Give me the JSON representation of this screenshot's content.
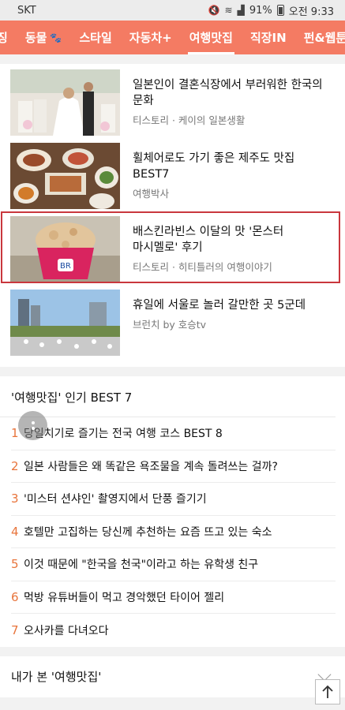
{
  "status": {
    "carrier": "SKT",
    "battery": "91%",
    "time": "오전 9:33"
  },
  "tabs": [
    {
      "label": "징"
    },
    {
      "label": "동물"
    },
    {
      "label": "스타일"
    },
    {
      "label": "자동차+"
    },
    {
      "label": "여행맛집"
    },
    {
      "label": "직장IN"
    },
    {
      "label": "펀&웹툰"
    }
  ],
  "articles": [
    {
      "title": "일본인이 결혼식장에서 부러워한 한국의 문화",
      "source": "티스토리 · 케이의 일본생활"
    },
    {
      "title": "휠체어로도 가기 좋은 제주도 맛집 BEST7",
      "source": "여행박사"
    },
    {
      "title": "배스킨라빈스 이달의 맛 '몬스터 마시멜로' 후기",
      "source": "티스토리 · 히티틀러의 여행이야기"
    },
    {
      "title": "휴일에 서울로 놀러 갈만한 곳 5군데",
      "source": "브런치 by 호승tv"
    }
  ],
  "best": {
    "title": "'여행맛집' 인기 BEST 7",
    "items": [
      {
        "rank": "1",
        "text": "당일치기로 즐기는 전국 여행 코스 BEST 8"
      },
      {
        "rank": "2",
        "text": "일본 사람들은 왜 똑같은 욕조물을 계속 돌려쓰는 걸까?"
      },
      {
        "rank": "3",
        "text": "'미스터 션샤인' 촬영지에서 단풍 즐기기"
      },
      {
        "rank": "4",
        "text": "호텔만 고집하는 당신께 추천하는 요즘 뜨고 있는 숙소"
      },
      {
        "rank": "5",
        "text": "이것 때문에 \"한국을 천국\"이라고 하는 유학생 친구"
      },
      {
        "rank": "6",
        "text": "먹방 유튜버들이 먹고 경악했던 타이어 젤리"
      },
      {
        "rank": "7",
        "text": "오사카를 다녀오다"
      }
    ]
  },
  "seen": {
    "label": "내가 본 '여행맛집'"
  },
  "colors": {
    "accent": "#f47b63",
    "rank": "#e8743b",
    "highlight": "#c9373d"
  }
}
